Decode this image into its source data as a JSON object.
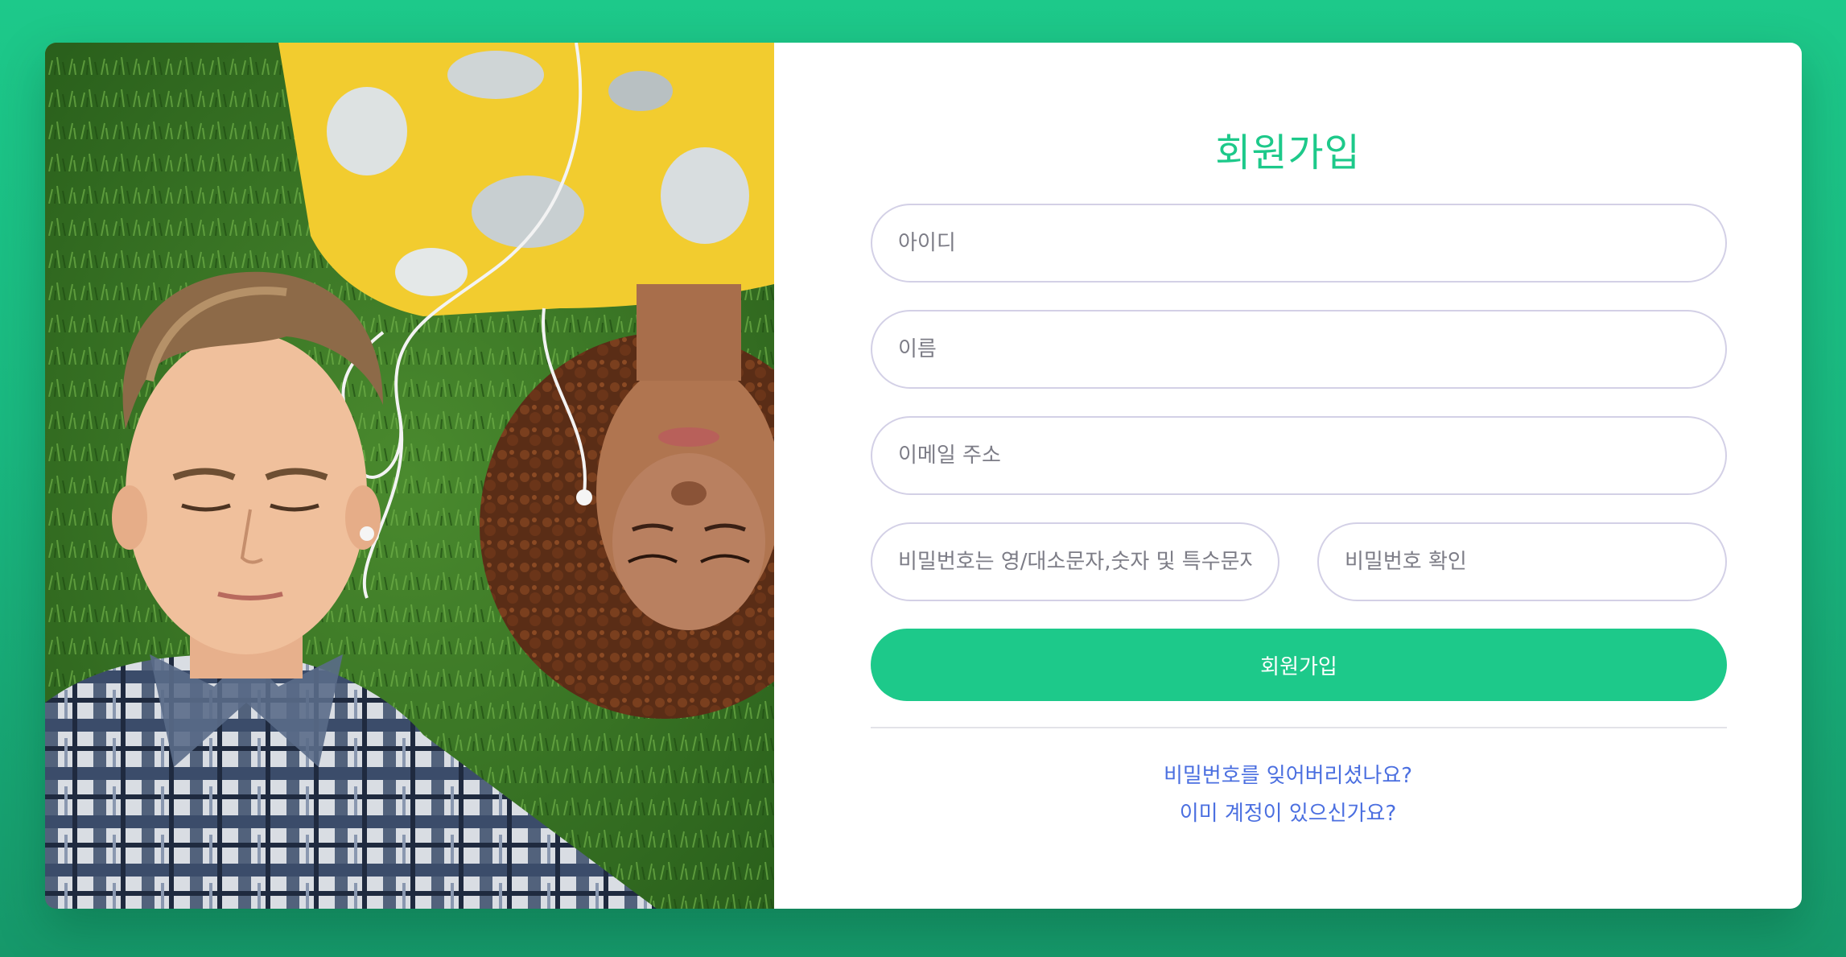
{
  "form": {
    "title": "회원가입",
    "fields": {
      "id_placeholder": "아이디",
      "name_placeholder": "이름",
      "email_placeholder": "이메일 주소",
      "password_placeholder": "비밀번호는 영/대소문자,숫자 및 특수문자",
      "password_confirm_placeholder": "비밀번호 확인"
    },
    "submit_label": "회원가입",
    "forgot_password_link": "비밀번호를 잊어버리셨나요?",
    "existing_account_link": "이미 계정이 있으신가요?"
  },
  "photo": {
    "alt": "Two people lying on grass with earphones"
  },
  "colors": {
    "accent": "#1dc98a",
    "link": "#4b6fe0",
    "field_border": "#d3d0e6",
    "background_top": "#1dc98a",
    "background_bottom": "#16986a"
  }
}
